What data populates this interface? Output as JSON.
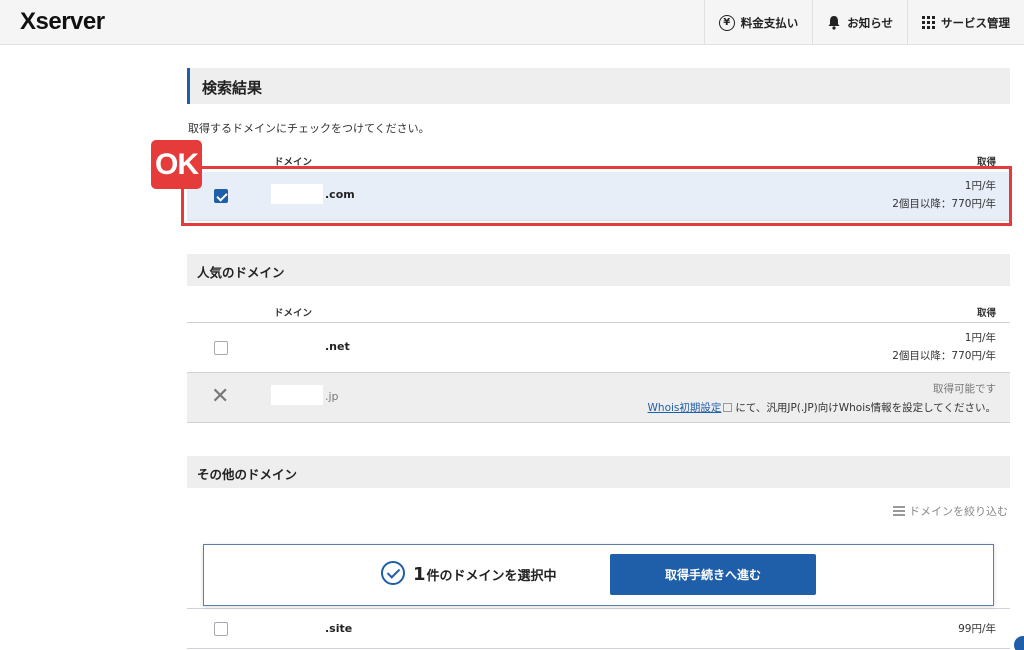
{
  "header": {
    "logo": "Xserver",
    "nav": [
      {
        "icon": "yen-icon",
        "label": "料金支払い"
      },
      {
        "icon": "bell-icon",
        "label": "お知らせ"
      },
      {
        "icon": "grid-icon",
        "label": "サービス管理"
      }
    ]
  },
  "search_results": {
    "title": "検索結果",
    "instruction": "取得するドメインにチェックをつけてください。",
    "col_domain": "ドメイン",
    "col_acquire": "取得",
    "badge": "OK",
    "row": {
      "tld": ".com",
      "checked": true,
      "price1": "1円/年",
      "price2": "2個目以降：770円/年"
    }
  },
  "popular": {
    "title": "人気のドメイン",
    "col_domain": "ドメイン",
    "col_acquire": "取得",
    "net": {
      "tld": ".net",
      "checked": false,
      "price1": "1円/年",
      "price2": "2個目以降：770円/年"
    },
    "jp": {
      "tld": ".jp",
      "status": "取得可能です",
      "link": "Whois初期設定",
      "note": "にて、汎用JP(.JP)向けWhois情報を設定してください。"
    }
  },
  "other": {
    "title": "その他のドメイン",
    "filter": "ドメインを絞り込む",
    "site": {
      "tld": ".site",
      "checked": false,
      "price": "99円/年"
    }
  },
  "selection_bar": {
    "count": "1",
    "text": "件のドメインを選択中",
    "button": "取得手続きへ進む"
  },
  "colors": {
    "accent": "#1f5ea8",
    "highlight": "#e53b3b",
    "selected_row": "#e7eef8"
  }
}
